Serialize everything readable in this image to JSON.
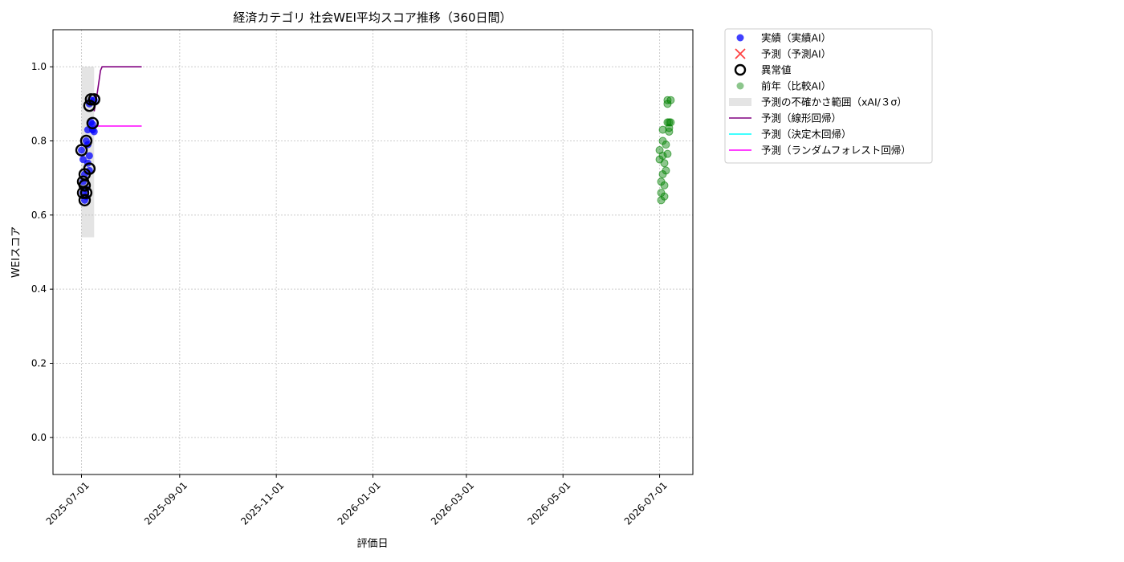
{
  "chart_data": {
    "type": "scatter",
    "title": "経済カテゴリ 社会WEI平均スコア推移（360日間）",
    "xlabel": "評価日",
    "ylabel": "WEIスコア",
    "ylim": [
      -0.1,
      1.1
    ],
    "xlim": [
      "2025-06-13",
      "2026-07-22"
    ],
    "y_ticks": [
      "0.0",
      "0.2",
      "0.4",
      "0.6",
      "0.8",
      "1.0"
    ],
    "y_tick_values": [
      0.0,
      0.2,
      0.4,
      0.6,
      0.8,
      1.0
    ],
    "x_ticks": [
      "2025-07-01",
      "2025-09-01",
      "2025-11-01",
      "2026-01-01",
      "2026-03-01",
      "2026-05-01",
      "2026-07-01"
    ],
    "grid": true,
    "legend_position": "outside-top-right",
    "legend": [
      {
        "label": "実績（実績AI）",
        "marker": "dot",
        "color": "#0000ff"
      },
      {
        "label": "予測（予測AI）",
        "marker": "x",
        "color": "#ff0000"
      },
      {
        "label": "異常値",
        "marker": "ring",
        "color": "#000000"
      },
      {
        "label": "前年（比較AI）",
        "marker": "dot",
        "color": "#008000"
      },
      {
        "label": "予測の不確かさ範囲（xAI/３σ）",
        "marker": "band",
        "color": "#bbbbbb"
      },
      {
        "label": "予測（線形回帰）",
        "marker": "line",
        "color": "#800080"
      },
      {
        "label": "予測（決定木回帰）",
        "marker": "line",
        "color": "#00ffff"
      },
      {
        "label": "予測（ランダムフォレスト回帰）",
        "marker": "line",
        "color": "#ff00ff"
      }
    ],
    "series": [
      {
        "name": "実績（実績AI）",
        "color": "#0000ff",
        "points": [
          {
            "x": "2025-07-01",
            "y": 0.775
          },
          {
            "x": "2025-07-02",
            "y": 0.75
          },
          {
            "x": "2025-07-02",
            "y": 0.69
          },
          {
            "x": "2025-07-02",
            "y": 0.66
          },
          {
            "x": "2025-07-03",
            "y": 0.64
          },
          {
            "x": "2025-07-03",
            "y": 0.71
          },
          {
            "x": "2025-07-04",
            "y": 0.8
          },
          {
            "x": "2025-07-04",
            "y": 0.65
          },
          {
            "x": "2025-07-04",
            "y": 0.67
          },
          {
            "x": "2025-07-05",
            "y": 0.83
          },
          {
            "x": "2025-07-05",
            "y": 0.79
          },
          {
            "x": "2025-07-05",
            "y": 0.74
          },
          {
            "x": "2025-07-06",
            "y": 0.72
          },
          {
            "x": "2025-07-06",
            "y": 0.76
          },
          {
            "x": "2025-07-06",
            "y": 0.9
          },
          {
            "x": "2025-07-07",
            "y": 0.85
          },
          {
            "x": "2025-07-07",
            "y": 0.91
          },
          {
            "x": "2025-07-08",
            "y": 0.83
          },
          {
            "x": "2025-07-08",
            "y": 0.845
          },
          {
            "x": "2025-07-09",
            "y": 0.91
          },
          {
            "x": "2025-07-09",
            "y": 0.825
          }
        ]
      },
      {
        "name": "異常値",
        "color": "#000000",
        "points": [
          {
            "x": "2025-07-01",
            "y": 0.775
          },
          {
            "x": "2025-07-02",
            "y": 0.69
          },
          {
            "x": "2025-07-02",
            "y": 0.66
          },
          {
            "x": "2025-07-03",
            "y": 0.64
          },
          {
            "x": "2025-07-03",
            "y": 0.71
          },
          {
            "x": "2025-07-03",
            "y": 0.68
          },
          {
            "x": "2025-07-04",
            "y": 0.8
          },
          {
            "x": "2025-07-04",
            "y": 0.66
          },
          {
            "x": "2025-07-06",
            "y": 0.725
          },
          {
            "x": "2025-07-06",
            "y": 0.895
          },
          {
            "x": "2025-07-07",
            "y": 0.912
          },
          {
            "x": "2025-07-08",
            "y": 0.848
          },
          {
            "x": "2025-07-09",
            "y": 0.912
          }
        ]
      },
      {
        "name": "前年（比較AI）",
        "color": "#008000",
        "points": [
          {
            "x": "2026-07-01",
            "y": 0.775
          },
          {
            "x": "2026-07-01",
            "y": 0.75
          },
          {
            "x": "2026-07-02",
            "y": 0.69
          },
          {
            "x": "2026-07-02",
            "y": 0.66
          },
          {
            "x": "2026-07-02",
            "y": 0.64
          },
          {
            "x": "2026-07-03",
            "y": 0.83
          },
          {
            "x": "2026-07-03",
            "y": 0.8
          },
          {
            "x": "2026-07-03",
            "y": 0.71
          },
          {
            "x": "2026-07-03",
            "y": 0.76
          },
          {
            "x": "2026-07-04",
            "y": 0.65
          },
          {
            "x": "2026-07-04",
            "y": 0.68
          },
          {
            "x": "2026-07-04",
            "y": 0.74
          },
          {
            "x": "2026-07-05",
            "y": 0.79
          },
          {
            "x": "2026-07-05",
            "y": 0.72
          },
          {
            "x": "2026-07-06",
            "y": 0.91
          },
          {
            "x": "2026-07-06",
            "y": 0.9
          },
          {
            "x": "2026-07-06",
            "y": 0.85
          },
          {
            "x": "2026-07-06",
            "y": 0.765
          },
          {
            "x": "2026-07-07",
            "y": 0.825
          },
          {
            "x": "2026-07-07",
            "y": 0.85
          },
          {
            "x": "2026-07-07",
            "y": 0.835
          },
          {
            "x": "2026-07-08",
            "y": 0.91
          },
          {
            "x": "2026-07-08",
            "y": 0.85
          }
        ]
      },
      {
        "name": "予測（線形回帰）",
        "color": "#800080",
        "line": [
          {
            "x": "2025-07-09",
            "y": 0.88
          },
          {
            "x": "2025-07-11",
            "y": 0.93
          },
          {
            "x": "2025-07-13",
            "y": 0.99
          },
          {
            "x": "2025-07-14",
            "y": 1.0
          },
          {
            "x": "2025-08-08",
            "y": 1.0
          }
        ]
      },
      {
        "name": "予測（ランダムフォレスト回帰）",
        "color": "#ff00ff",
        "line": [
          {
            "x": "2025-07-09",
            "y": 0.84
          },
          {
            "x": "2025-08-08",
            "y": 0.84
          }
        ]
      },
      {
        "name": "予測の不確かさ範囲（xAI/３σ）",
        "color": "#bbbbbb",
        "band": {
          "x0": "2025-07-01",
          "x1": "2025-07-09",
          "y0": 0.54,
          "y1": 1.0
        }
      }
    ]
  }
}
